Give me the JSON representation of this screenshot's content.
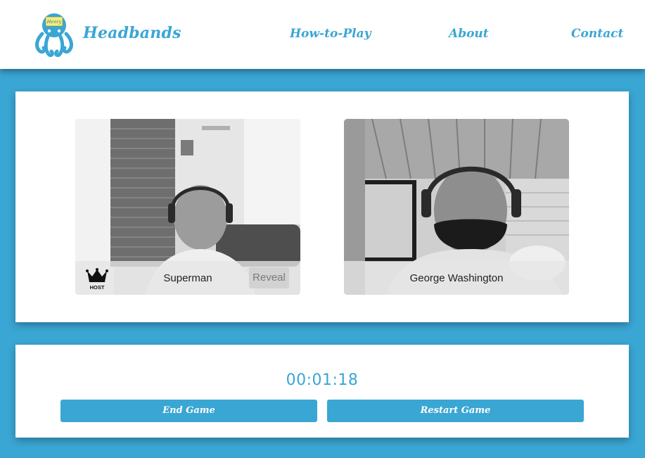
{
  "header": {
    "brand": "Headbands",
    "logo_tag": "Henry",
    "nav": {
      "how_to_play": "How-to-Play",
      "about": "About",
      "contact": "Contact"
    }
  },
  "players": [
    {
      "name": "Superman",
      "reveal_label": "Reveal",
      "host_label": "HOST",
      "is_host": true
    },
    {
      "name": "George Washington"
    }
  ],
  "game": {
    "timer": "00:01:18",
    "end_label": "End Game",
    "restart_label": "Restart Game"
  },
  "colors": {
    "accent": "#3aa6d4",
    "panel": "#ffffff"
  }
}
